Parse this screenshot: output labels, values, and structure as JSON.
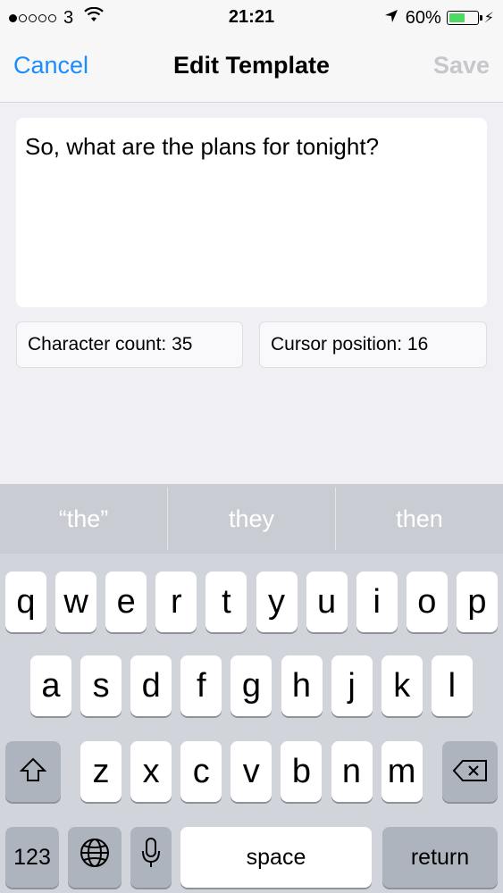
{
  "status_bar": {
    "carrier": "3",
    "time": "21:21",
    "battery": "60%",
    "battery_level": 0.6
  },
  "nav": {
    "cancel": "Cancel",
    "title": "Edit Template",
    "save": "Save"
  },
  "editor": {
    "text": "So, what are the plans for tonight?"
  },
  "info": {
    "character_count": "Character count: 35",
    "cursor_position": "Cursor position: 16"
  },
  "keyboard": {
    "suggestions": [
      "“the”",
      "they",
      "then"
    ],
    "row1": [
      "q",
      "w",
      "e",
      "r",
      "t",
      "y",
      "u",
      "i",
      "o",
      "p"
    ],
    "row2": [
      "a",
      "s",
      "d",
      "f",
      "g",
      "h",
      "j",
      "k",
      "l"
    ],
    "row3": [
      "z",
      "x",
      "c",
      "v",
      "b",
      "n",
      "m"
    ],
    "numbers_key": "123",
    "space_key": "space",
    "return_key": "return"
  },
  "colors": {
    "accent": "#1a8cff",
    "disabled": "#c6c6cb",
    "battery_fill": "#4cd964"
  }
}
